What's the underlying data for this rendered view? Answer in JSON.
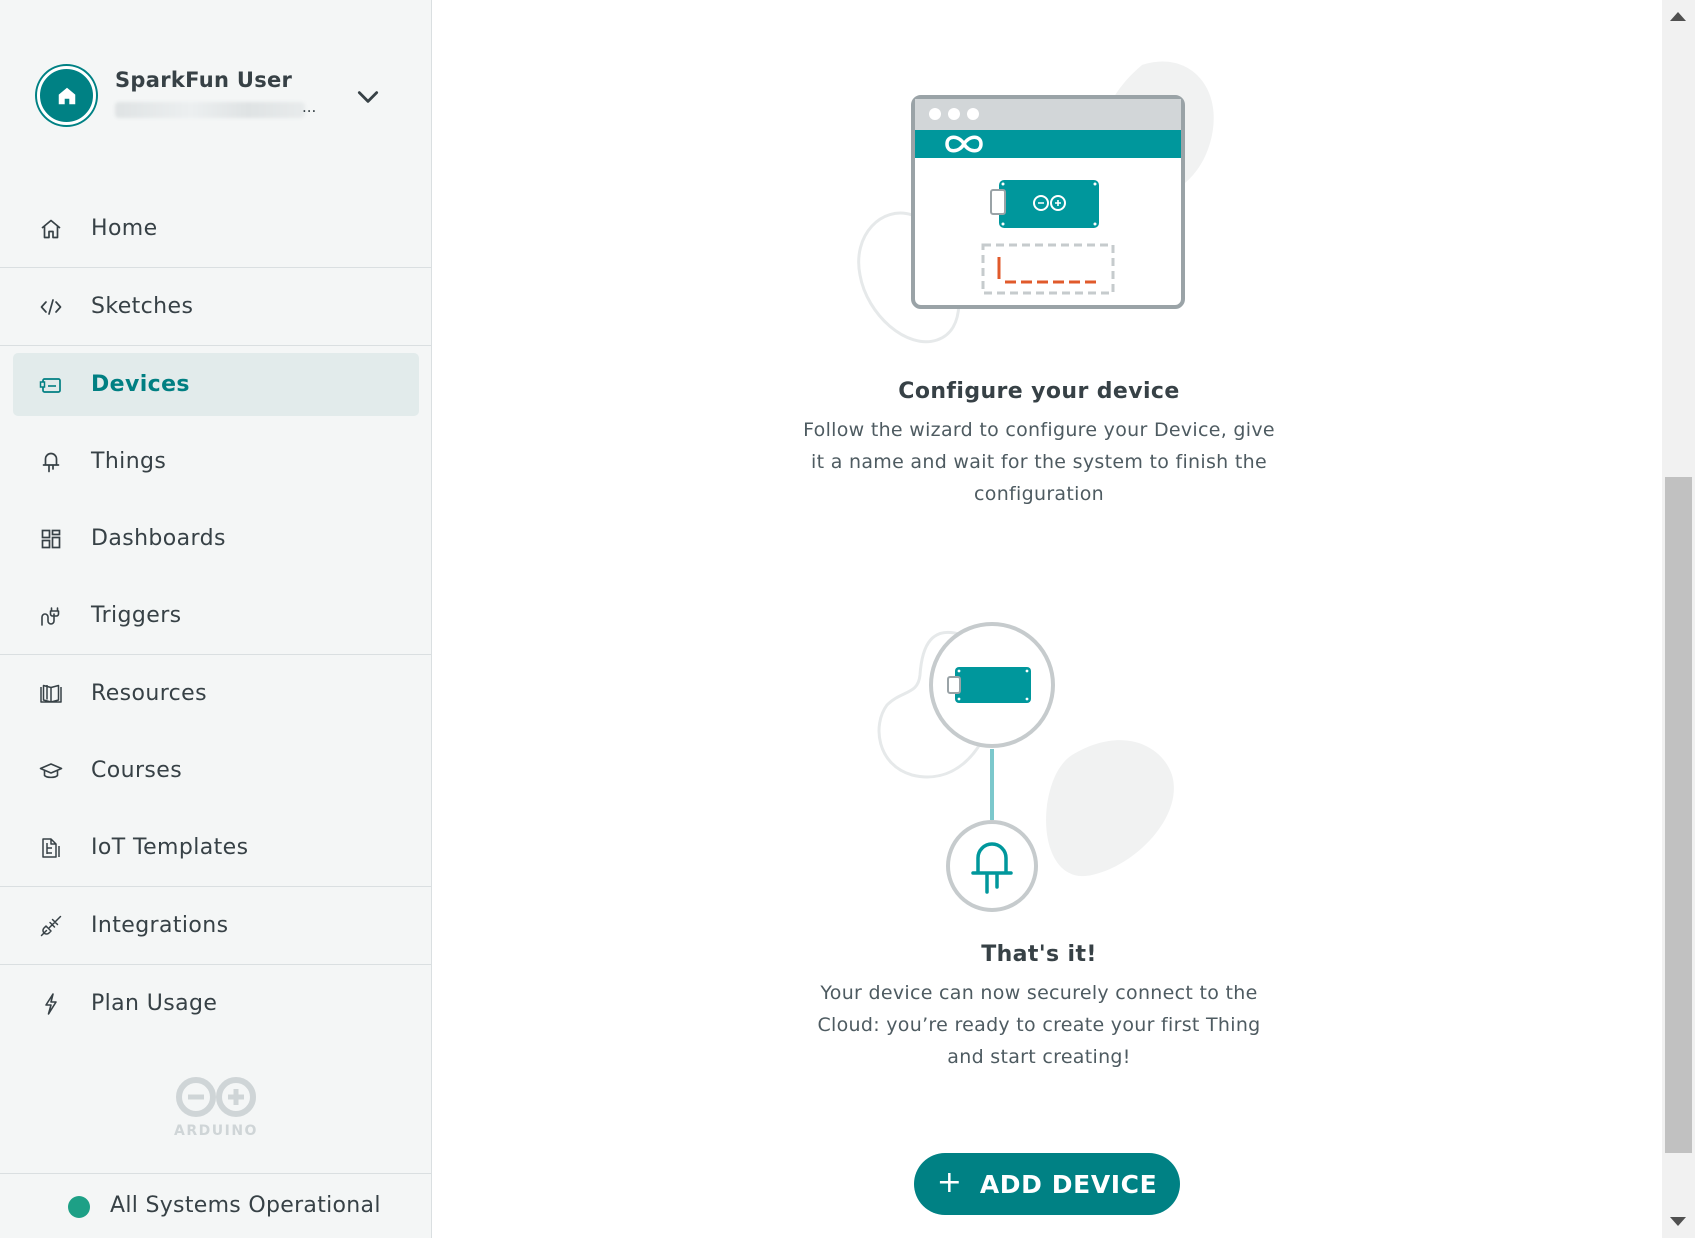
{
  "user": {
    "name": "SparkFun User",
    "email_ellipsis": "...",
    "avatar_icon": "home-icon",
    "menu_icon": "chevron-down-icon"
  },
  "nav": {
    "items": [
      {
        "label": "Home",
        "icon": "home-icon"
      },
      {
        "label": "Sketches",
        "icon": "code-icon"
      },
      {
        "label": "Devices",
        "icon": "device-icon",
        "active": true
      },
      {
        "label": "Things",
        "icon": "led-icon"
      },
      {
        "label": "Dashboards",
        "icon": "dashboard-icon"
      },
      {
        "label": "Triggers",
        "icon": "trigger-icon"
      },
      {
        "label": "Resources",
        "icon": "book-icon"
      },
      {
        "label": "Courses",
        "icon": "graduation-cap-icon"
      },
      {
        "label": "IoT Templates",
        "icon": "templates-icon"
      },
      {
        "label": "Integrations",
        "icon": "plug-icon"
      },
      {
        "label": "Plan Usage",
        "icon": "lightning-icon"
      }
    ]
  },
  "logo_text": "ARDUINO",
  "status": {
    "text": "All Systems Operational",
    "color": "#1da086"
  },
  "steps": [
    {
      "title": "Configure your device",
      "description": "Follow the wizard to configure your Device, give it a name and wait for the system to finish the configuration"
    },
    {
      "title": "That's it!",
      "description": "Your device can now securely connect to the Cloud: you’re ready to create your first Thing and start creating!"
    }
  ],
  "add_button": {
    "label": "ADD DEVICE",
    "plus": "+"
  },
  "colors": {
    "accent": "#008184",
    "active_bg": "#e2ebeb",
    "sidebar_bg": "#f4f6f6"
  }
}
